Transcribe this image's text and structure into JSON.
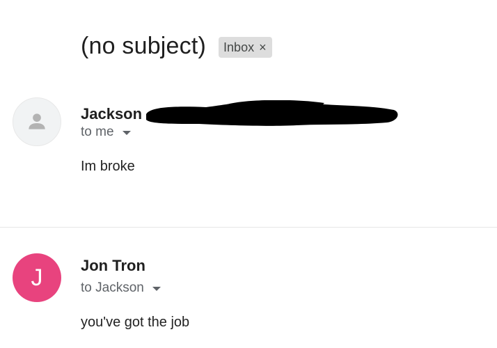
{
  "thread": {
    "subject": "(no subject)",
    "label": "Inbox",
    "label_remove_glyph": "×"
  },
  "messages": [
    {
      "sender": "Jackson",
      "recipient": "to me",
      "body": "Im broke",
      "avatar_icon": "default-person-avatar-icon",
      "sender_redacted": true
    },
    {
      "sender": "Jon Tron",
      "recipient": "to Jackson",
      "body": "you've got the job",
      "avatar_letter": "J",
      "avatar_color": "#e8437e"
    }
  ]
}
